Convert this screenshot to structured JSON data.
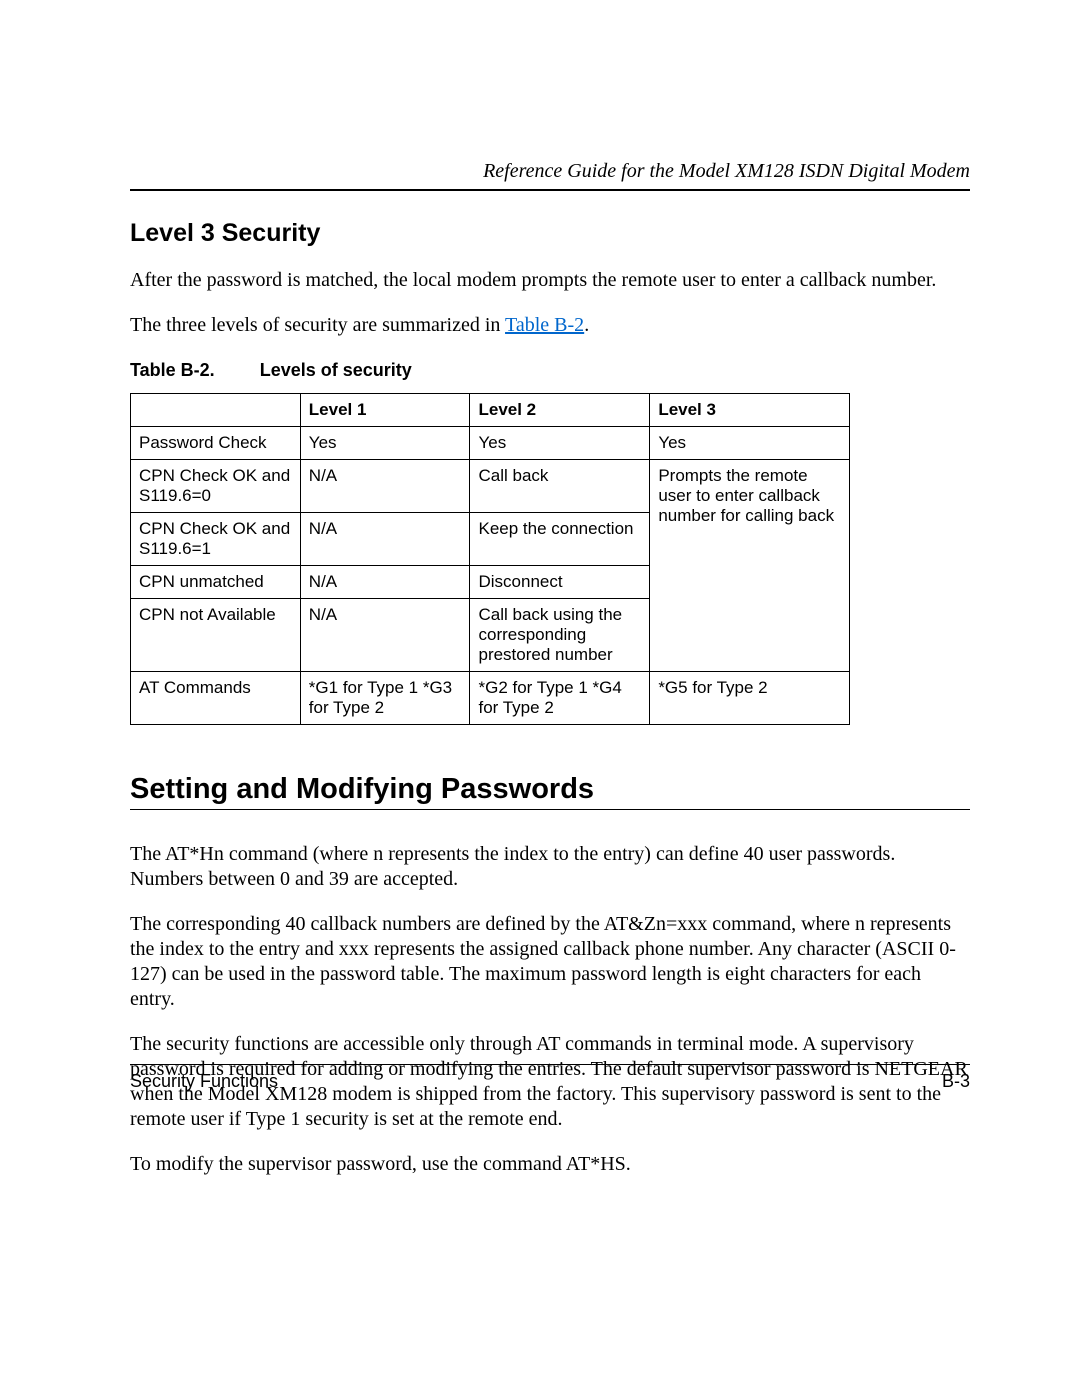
{
  "header": {
    "doc_title": "Reference Guide for the Model XM128 ISDN Digital Modem"
  },
  "section1": {
    "heading": "Level 3 Security",
    "para1": "After the password is matched, the local modem prompts the remote user to enter a callback number.",
    "para2_pre": "The three levels of security are summarized in ",
    "para2_link": "Table B-2",
    "para2_post": "."
  },
  "table": {
    "caption_number": "Table B-2.",
    "caption_title": "Levels of security",
    "head": {
      "c0": "",
      "c1": "Level 1",
      "c2": "Level 2",
      "c3": "Level 3"
    },
    "rows": {
      "r0": {
        "c0": "Password Check",
        "c1": "Yes",
        "c2": "Yes",
        "c3": "Yes"
      },
      "r1": {
        "c0": "CPN Check OK and S119.6=0",
        "c1": "N/A",
        "c2": "Call back",
        "c3": "Prompts the remote user to enter callback number for calling back"
      },
      "r2": {
        "c0": "CPN Check OK and S119.6=1",
        "c1": "N/A",
        "c2": "Keep the connection"
      },
      "r3": {
        "c0": "CPN unmatched",
        "c1": "N/A",
        "c2": "Disconnect"
      },
      "r4": {
        "c0": "CPN not Available",
        "c1": "N/A",
        "c2": "Call back using the corresponding prestored number"
      },
      "r5": {
        "c0": "AT Commands",
        "c1": "*G1 for Type 1 *G3 for Type 2",
        "c2": "*G2 for Type 1 *G4 for Type 2",
        "c3": "*G5 for Type 2"
      }
    }
  },
  "section2": {
    "heading": "Setting and Modifying Passwords",
    "para1": "The AT*Hn command (where n represents the index to the entry) can define 40 user passwords. Numbers between 0 and 39 are accepted.",
    "para2": "The corresponding 40 callback numbers are defined by the AT&Zn=xxx command, where n represents the index to the entry and xxx represents the assigned callback phone number. Any character (ASCII 0-127) can be used in the password table. The maximum password length is eight characters for each entry.",
    "para3": "The security functions are accessible only through AT commands in terminal mode. A supervisory password is required for adding or modifying the entries. The default supervisor password is NETGEAR when the Model XM128 modem is shipped from the factory. This supervisory password is sent to the remote user if Type 1 security is set at the remote end.",
    "para4": "To modify the supervisor password, use the command AT*HS."
  },
  "footer": {
    "left": "Security Functions",
    "right": "B-3"
  }
}
